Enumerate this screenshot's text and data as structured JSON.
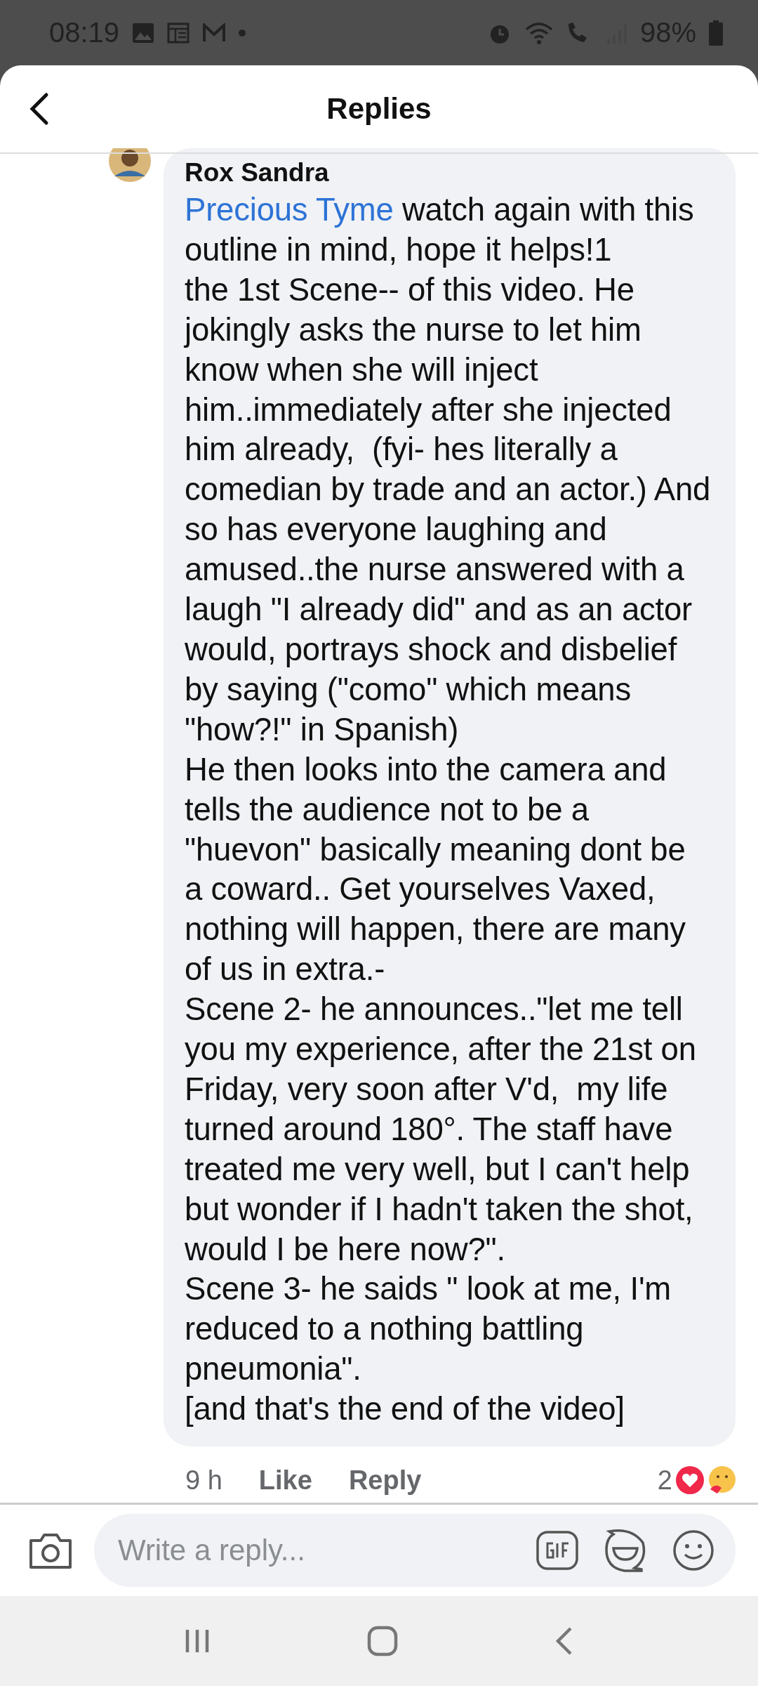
{
  "status_bar": {
    "time": "08:19",
    "battery": "98%"
  },
  "header": {
    "title": "Replies"
  },
  "comment": {
    "author": "Rox Sandra",
    "mention": "Precious Tyme",
    "text": " watch again with this outline in mind, hope it helps!1\nthe 1st Scene-- of this video. He jokingly asks the nurse to let him know when she will inject him..immediately after she injected him already,  (fyi- hes literally a comedian by trade and an actor.) And so has everyone laughing and amused..the nurse answered with a laugh \"I already did\" and as an actor would, portrays shock and disbelief by saying (\"como\" which means \"how?!\" in Spanish)\nHe then looks into the camera and tells the audience not to be a \"huevon\" basically meaning dont be a coward.. Get yourselves Vaxed, nothing will happen, there are many of us in extra.-\nScene 2- he announces..\"let me tell you my experience, after the 21st on Friday, very soon after V'd,  my life turned around 180°. The staff have treated me very well, but I can't help but wonder if I hadn't taken the shot, would I be here now?\".\nScene 3- he saids \" look at me, I'm reduced to a nothing battling pneumonia\".\n[and that's the end of the video]",
    "time": "9 h",
    "actions": [
      "Like",
      "Reply"
    ],
    "reaction_count": "2"
  },
  "composer": {
    "placeholder": "Write a reply..."
  }
}
